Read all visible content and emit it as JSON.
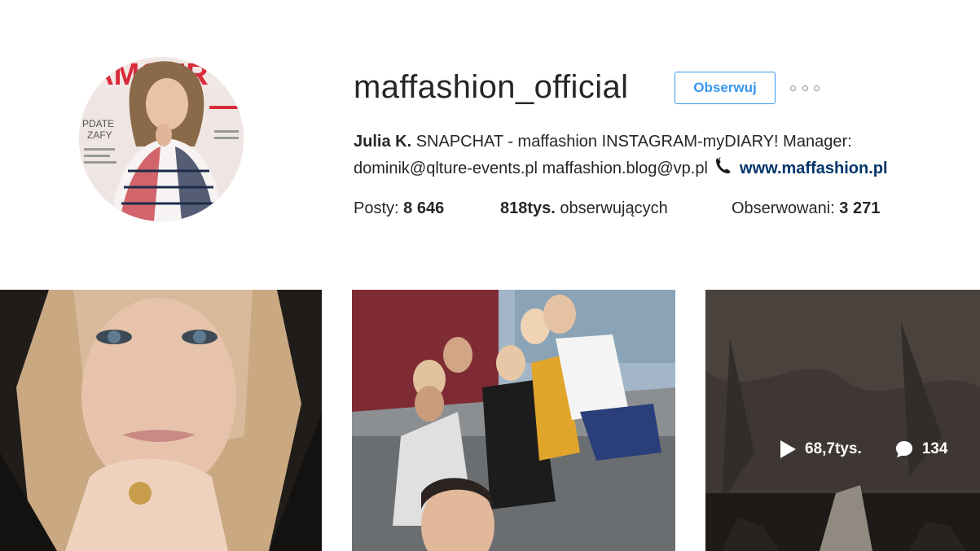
{
  "profile": {
    "username": "maffashion_official",
    "follow_label": "Obserwuj",
    "more_icon": "more-options-icon",
    "bio": {
      "name": "Julia K.",
      "line1": "SNAPCHAT - maffashion INSTAGRAM-myDIARY! Manager:",
      "line2": "dominik@qlture-events.pl maffashion.blog@vp.pl",
      "link": "www.maffashion.pl"
    },
    "stats": {
      "posts_label": "Posty:",
      "posts_value": "8 646",
      "followers_value": "818tys.",
      "followers_label": "obserwujących",
      "following_label": "Obserwowani:",
      "following_value": "3 271"
    }
  },
  "posts": [
    {
      "kind": "photo"
    },
    {
      "kind": "photo"
    },
    {
      "kind": "video",
      "views": "68,7tys.",
      "comments": "134"
    }
  ],
  "colors": {
    "accent": "#3897f0",
    "link": "#003569",
    "text": "#262626",
    "muted": "#8e8e8e"
  }
}
